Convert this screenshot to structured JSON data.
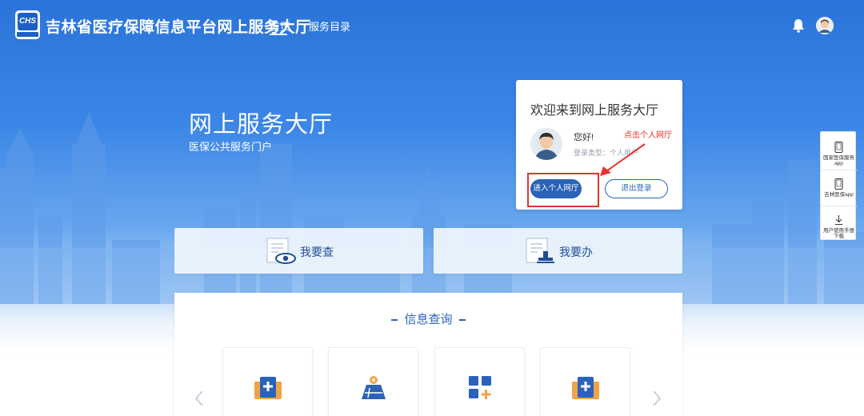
{
  "header": {
    "logo_text": "CHS",
    "site_title": "吉林省医疗保障信息平台网上服务大厅",
    "nav": [
      {
        "label": "首页",
        "active": true
      },
      {
        "label": "服务目录",
        "active": false
      }
    ],
    "icons": [
      "bell-icon",
      "user-avatar"
    ]
  },
  "hero": {
    "title": "网上服务大厅",
    "subtitle": "医保公共服务门户"
  },
  "welcome_card": {
    "title": "欢迎来到网上服务大厅",
    "greeting": "您好!",
    "login_type": "登录类型：个人用户",
    "enter_button": "进入个人网厅",
    "logout_button": "退出登录"
  },
  "annotation": {
    "text": "点击个人网厅",
    "color": "#e5322d"
  },
  "float_bar": {
    "items": [
      {
        "label": "国家医保服务app",
        "icon": "phone-icon"
      },
      {
        "label": "吉林医保app",
        "icon": "phone-icon"
      },
      {
        "label": "用户使用手册下载",
        "icon": "download-icon"
      }
    ]
  },
  "actions": {
    "query": "我要查",
    "handle": "我要办"
  },
  "info_panel": {
    "title": "信息查询",
    "cards": [
      "medical-kit-icon",
      "map-location-icon",
      "service-grid-icon",
      "medical-kit-icon"
    ]
  },
  "colors": {
    "primary": "#2a63b8",
    "hero_top": "#2a74d9",
    "accent_orange": "#f0a448"
  }
}
